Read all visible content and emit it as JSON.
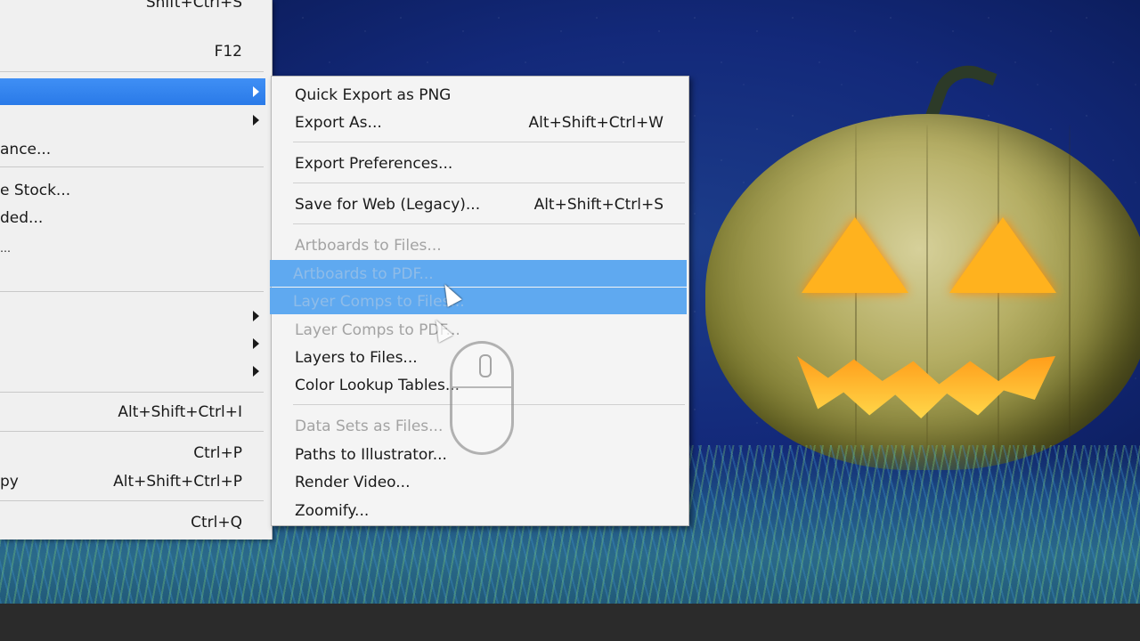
{
  "parent_menu": {
    "items": [
      {
        "label": "",
        "shortcut": "Shift+Ctrl+S"
      },
      {
        "label": "",
        "shortcut": "F12"
      },
      {
        "label": "",
        "shortcut": ""
      },
      {
        "label": "",
        "shortcut": ""
      },
      {
        "label": "ance...",
        "shortcut": ""
      },
      {
        "label": "e Stock...",
        "shortcut": ""
      },
      {
        "label": "ded...",
        "shortcut": ""
      },
      {
        "label": "",
        "shortcut": ""
      },
      {
        "label": "",
        "shortcut": ""
      },
      {
        "label": "",
        "shortcut": ""
      },
      {
        "label": "",
        "shortcut": ""
      },
      {
        "label": "",
        "shortcut": "Alt+Shift+Ctrl+I"
      },
      {
        "label": "",
        "shortcut": "Ctrl+P"
      },
      {
        "label": "py",
        "shortcut": "Alt+Shift+Ctrl+P"
      },
      {
        "label": "",
        "shortcut": "Ctrl+Q"
      }
    ]
  },
  "submenu": {
    "items": [
      {
        "label": "Quick Export as PNG",
        "shortcut": ""
      },
      {
        "label": "Export As...",
        "shortcut": "Alt+Shift+Ctrl+W"
      },
      {
        "label": "Export Preferences...",
        "shortcut": ""
      },
      {
        "label": "Save for Web (Legacy)...",
        "shortcut": "Alt+Shift+Ctrl+S"
      },
      {
        "label": "Artboards to Files...",
        "shortcut": ""
      },
      {
        "label": "Artboards to PDF...",
        "shortcut": ""
      },
      {
        "label": "Layer Comps to Files...",
        "shortcut": ""
      },
      {
        "label": "Layer Comps to PDF...",
        "shortcut": ""
      },
      {
        "label": "Layers to Files...",
        "shortcut": ""
      },
      {
        "label": "Color Lookup Tables...",
        "shortcut": ""
      },
      {
        "label": "Data Sets as Files...",
        "shortcut": ""
      },
      {
        "label": "Paths to Illustrator...",
        "shortcut": ""
      },
      {
        "label": "Render Video...",
        "shortcut": ""
      },
      {
        "label": "Zoomify...",
        "shortcut": ""
      }
    ]
  },
  "icons": {
    "mouse": "mouse-icon",
    "cursor": "arrow-cursor-icon",
    "submenu_arrow": "submenu-arrow-icon"
  },
  "colors": {
    "highlight": "#3f8ff5",
    "submenu_highlight": "#5fa9f0",
    "disabled_text": "#a3a3a3"
  }
}
